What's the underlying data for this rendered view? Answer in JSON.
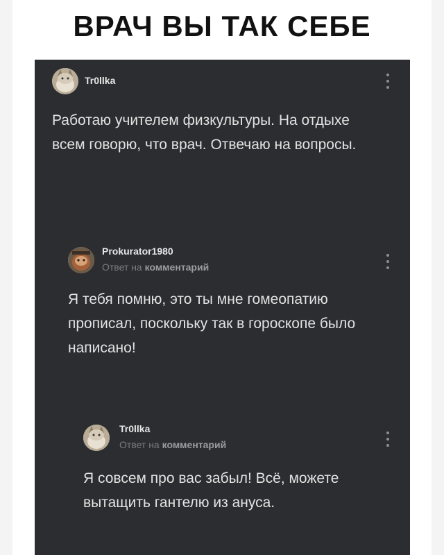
{
  "meme_title": "ВРАЧ ВЫ ТАК СЕБЕ",
  "comments": [
    {
      "username": "Tr0llka",
      "text": "Работаю учителем физкультуры. На отдыхе всем говорю, что врач. Отвечаю на вопросы."
    },
    {
      "username": "Prokurator1980",
      "reply_prefix": "Ответ на",
      "reply_target": "комментарий",
      "text": "Я тебя помню, это ты мне гомеопатию прописал, поскольку так в гороскопе было написано!"
    },
    {
      "username": "Tr0llka",
      "reply_prefix": "Ответ на",
      "reply_target": "комментарий",
      "text": "Я совсем про вас забыл! Всё, можете вытащить гантелю из ануса."
    }
  ],
  "colors": {
    "panel_bg": "#2b2d30",
    "text": "#e2e2e2",
    "muted": "#7a7c80"
  },
  "icons": [
    "avatar-cat",
    "more-vertical-icon"
  ]
}
